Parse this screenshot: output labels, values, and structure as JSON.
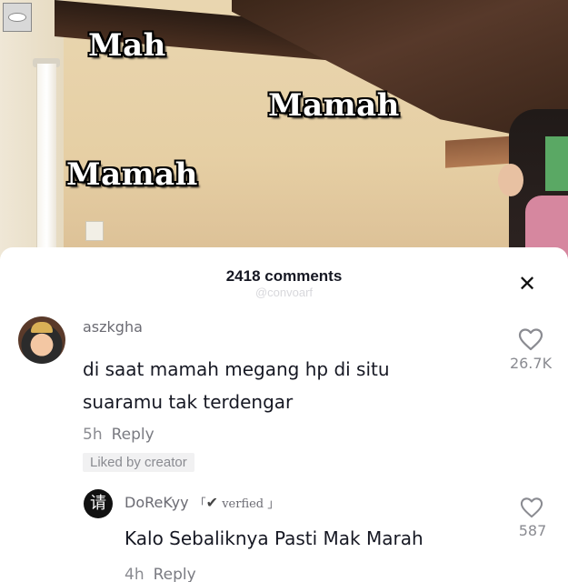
{
  "video": {
    "captions": [
      "Mah",
      "Mamah",
      "Mamah"
    ],
    "corner_icon": "app-badge-icon"
  },
  "comments_panel": {
    "count_label": "2418 comments",
    "watermark": "@convoarf",
    "close_icon": "close-icon"
  },
  "comments": [
    {
      "username": "aszkgha",
      "text_lines": [
        "di saat mamah megang hp di situ",
        "suaramu tak terdengar"
      ],
      "time": "5h",
      "reply_label": "Reply",
      "badge": "Liked by creator",
      "like_count": "26.7K",
      "like_icon": "heart-outline-icon"
    },
    {
      "username": "DoReKyy",
      "verified_label": "verfied",
      "avatar_glyph": "请",
      "text": "Kalo Sebaliknya Pasti Mak Marah",
      "time": "4h",
      "reply_label": "Reply",
      "like_count": "587",
      "like_icon": "heart-outline-icon"
    }
  ],
  "colors": {
    "text_primary": "#161823",
    "text_secondary": "#8a8b91",
    "panel_bg": "#ffffff"
  }
}
